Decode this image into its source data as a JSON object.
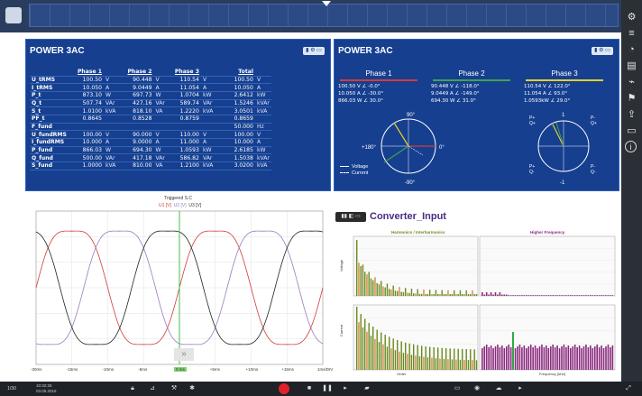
{
  "topbar": {
    "icons": [
      "camera-icon"
    ]
  },
  "right_toolbar": {
    "icons": [
      "gear-icon",
      "menu-icon",
      "gauge-icon",
      "report-icon",
      "marker-icon",
      "flag-icon",
      "export-icon",
      "print-icon",
      "info-icon"
    ]
  },
  "power_left": {
    "title": "POWER 3AC",
    "headers": [
      "",
      "Phase 1",
      "",
      "Phase 2",
      "",
      "Phase 3",
      "",
      "Total",
      ""
    ],
    "rows": [
      [
        "U_tRMS",
        "100.50",
        "V",
        "90.448",
        "V",
        "110.54",
        "V",
        "100.50",
        "V"
      ],
      [
        "I_tRMS",
        "10.050",
        "A",
        "9.0449",
        "A",
        "11.054",
        "A",
        "10.050",
        "A"
      ],
      [
        "P_t",
        "873.10",
        "W",
        "697.73",
        "W",
        "1.0704",
        "kW",
        "2.6412",
        "kW"
      ],
      [
        "Q_t",
        "507.74",
        "VAr",
        "427.16",
        "VAr",
        "589.74",
        "VAr",
        "1.5246",
        "kVAr"
      ],
      [
        "S_t",
        "1.0100",
        "kVA",
        "818.10",
        "VA",
        "1.2220",
        "kVA",
        "3.0501",
        "kVA"
      ],
      [
        "PF_t",
        "0.8645",
        "",
        "0.8528",
        "",
        "0.8759",
        "",
        "0.8659",
        ""
      ],
      [
        "F_fund",
        "",
        "",
        "",
        "",
        "",
        "",
        "50.000",
        "Hz"
      ],
      [
        "U_fundRMS",
        "100.00",
        "V",
        "90.000",
        "V",
        "110.00",
        "V",
        "100.00",
        "V"
      ],
      [
        "I_fundRMS",
        "10.000",
        "A",
        "9.0000",
        "A",
        "11.000",
        "A",
        "10.000",
        "A"
      ],
      [
        "P_fund",
        "866.03",
        "W",
        "694.30",
        "W",
        "1.0593",
        "kW",
        "2.6185",
        "kW"
      ],
      [
        "Q_fund",
        "500.00",
        "VAr",
        "417.18",
        "VAr",
        "586.82",
        "VAr",
        "1.5038",
        "kVAr"
      ],
      [
        "S_fund",
        "1.0000",
        "kVA",
        "810.00",
        "VA",
        "1.2100",
        "kVA",
        "3.0200",
        "kVA"
      ]
    ]
  },
  "power_right": {
    "title": "POWER 3AC",
    "phases": [
      {
        "label": "Phase 1",
        "color": "#d33b3b",
        "lines": [
          "100.50  V  ∠  -0.0°",
          "10.050  A  ∠ -30.0°",
          "866.03  W  ∠  30.0°"
        ],
        "top": "90°",
        "left": "+180°",
        "right": "0°",
        "bottom": "-90°"
      },
      {
        "label": "Phase 2",
        "color": "#3fa34d",
        "lines": [
          "90.448  V  ∠ -118.0°",
          "9.0449  A  ∠ -149.0°",
          "694.30  W  ∠  31.0°"
        ]
      },
      {
        "label": "Phase 3",
        "color": "#e2cf2c",
        "lines": [
          "110.54  V  ∠  122.0°",
          "11.054  A  ∠  93.0°",
          "1.0593kW  ∠  29.0°"
        ],
        "top": "1",
        "bottom": "-1",
        "tl": "P+\nQ+",
        "tr": "P-\nQ+",
        "bl": "P+\nQ-",
        "br": "P-\nQ-"
      }
    ],
    "legend": [
      "Voltage",
      "Current"
    ]
  },
  "waveform": {
    "title": "Triggered S.C",
    "legend": [
      "U1 [V]",
      "U2 [V]",
      "U3 [V]"
    ],
    "x_ticks": [
      "-20ms",
      "-15ms",
      "-10ms",
      "-5ms",
      "0 ms",
      "+5ms",
      "+10ms",
      "+15ms",
      "1ms/DIV"
    ],
    "cursor_label": "0 ms",
    "expand": "»"
  },
  "converter": {
    "title": "Converter_Input",
    "sec_left": "Harmonics / Interharmonics",
    "sec_right": "Higher Frequency",
    "y_top": "Voltage",
    "y_bottom": "Current",
    "x_left": "Order",
    "x_right": "Frequency [kHz]",
    "tools": "▮▮ ◧ ▭"
  },
  "statusbar": {
    "left1": "1/30",
    "time": "10:32:25",
    "date": "03.05.2016",
    "icons": [
      "lock-icon",
      "cursor-icon",
      "settings-icon",
      "record-button",
      "stop-icon",
      "pause-icon",
      "skip-icon",
      "folder-icon",
      "screen-icon",
      "user-icon",
      "cloud-icon",
      "fullscreen-icon"
    ]
  },
  "colors": {
    "panel": "#163f8f",
    "accent": "#2b5fc0",
    "ph1": "#d33b3b",
    "ph2": "#3fa34d",
    "ph3": "#e2cf2c",
    "harm": "#6a8a1e",
    "hf": "#8a2a7e"
  }
}
